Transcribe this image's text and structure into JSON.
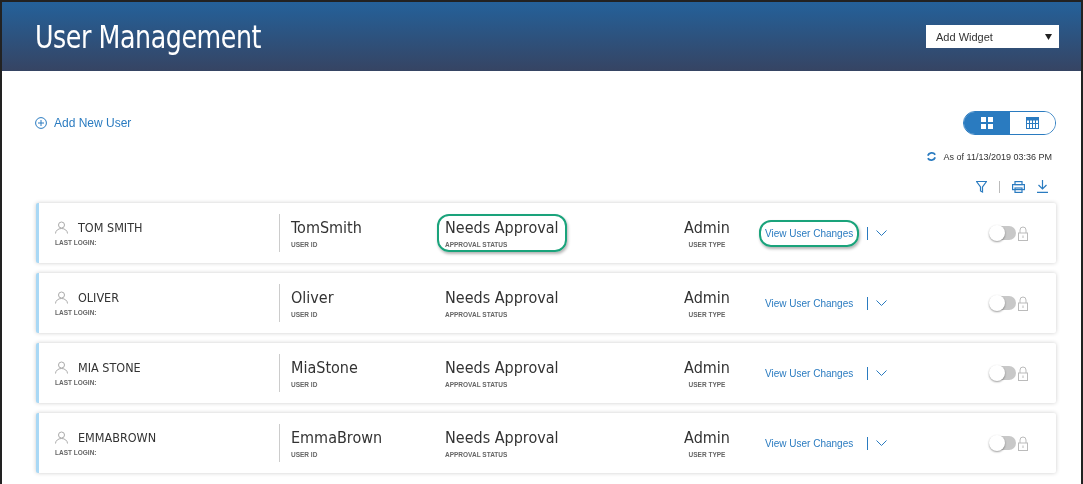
{
  "header": {
    "title": "User Management",
    "widget_select": {
      "value": "Add Widget"
    }
  },
  "add_user": {
    "label": "Add New User"
  },
  "view_toggle": [
    {
      "kind": "grid",
      "selected": true
    },
    {
      "kind": "calendar",
      "selected": false
    }
  ],
  "timestamp": "As of 11/13/2019 03:36 PM",
  "users": [
    {
      "name": "TOM SMITH",
      "last_login_label": "LAST LOGIN:",
      "user_id": "TomSmith",
      "user_id_label": "USER ID",
      "status": "Needs Approval",
      "status_label": "APPROVAL STATUS",
      "status_highlighted": true,
      "type": "Admin",
      "type_label": "USER TYPE",
      "link": "View User Changes",
      "link_highlighted": true,
      "enabled": false
    },
    {
      "name": "OLIVER",
      "last_login_label": "LAST LOGIN:",
      "user_id": "Oliver",
      "user_id_label": "USER ID",
      "status": "Needs Approval",
      "status_label": "APPROVAL STATUS",
      "status_highlighted": false,
      "type": "Admin",
      "type_label": "USER TYPE",
      "link": "View User Changes",
      "link_highlighted": false,
      "enabled": false
    },
    {
      "name": "MIA STONE",
      "last_login_label": "LAST LOGIN:",
      "user_id": "MiaStone",
      "user_id_label": "USER ID",
      "status": "Needs Approval",
      "status_label": "APPROVAL STATUS",
      "status_highlighted": false,
      "type": "Admin",
      "type_label": "USER TYPE",
      "link": "View User Changes",
      "link_highlighted": false,
      "enabled": false
    },
    {
      "name": "EMMABROWN",
      "last_login_label": "LAST LOGIN:",
      "user_id": "EmmaBrown",
      "user_id_label": "USER ID",
      "status": "Needs Approval",
      "status_label": "APPROVAL STATUS",
      "status_highlighted": false,
      "type": "Admin",
      "type_label": "USER TYPE",
      "link": "View User Changes",
      "link_highlighted": false,
      "enabled": false
    }
  ]
}
